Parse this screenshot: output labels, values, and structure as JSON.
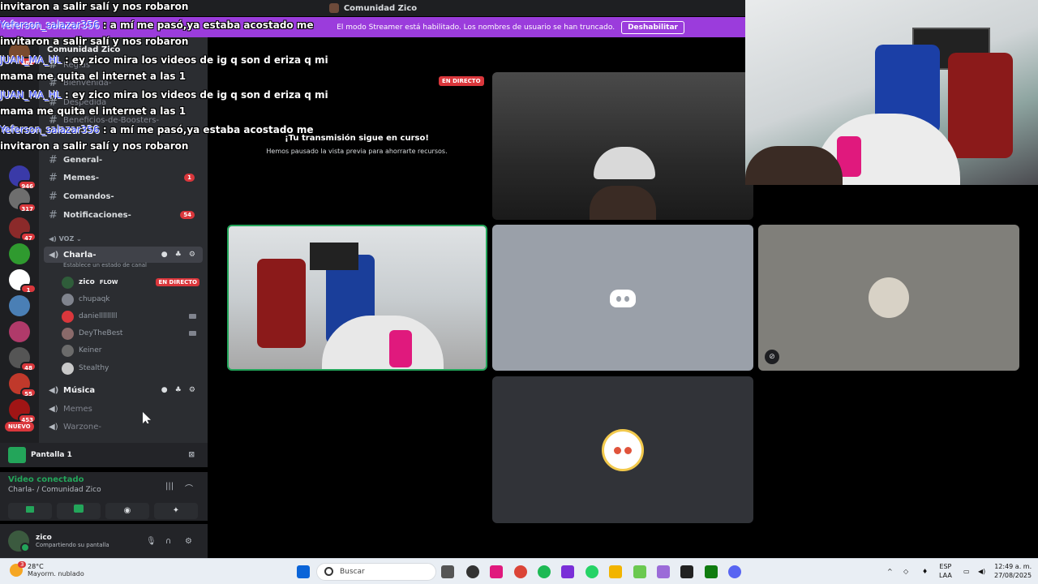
{
  "window": {
    "title": "Comunidad Zico"
  },
  "banner": {
    "text": "El modo Streamer está habilitado. Los nombres de usuario se han truncado.",
    "button": "Deshabilitar"
  },
  "servers": {
    "badges": [
      "682",
      "946",
      "317",
      "47",
      "1",
      "48",
      "55",
      "453"
    ],
    "nuevo": "NUEVO"
  },
  "channel_list": {
    "server_name": "Comunidad Zico",
    "faded": [
      "Reglas",
      "Bienvenida-",
      "Despedida",
      "Beneficios-de-Boosters-"
    ],
    "text_channels": [
      {
        "name": "General-",
        "unread": ""
      },
      {
        "name": "Memes-",
        "unread": "1"
      },
      {
        "name": "Comandos-",
        "unread": ""
      },
      {
        "name": "Notificaciones-",
        "unread": "54"
      }
    ],
    "voice_category": "VOZ",
    "voice_channels": [
      {
        "name": "Charla-",
        "status": "Establece un estado de canal"
      },
      {
        "name": "Música"
      },
      {
        "name": "Memes"
      },
      {
        "name": "Warzone-"
      }
    ],
    "members": [
      {
        "name": "zico",
        "tag": "FLOW",
        "live": "EN DIRECTO"
      },
      {
        "name": "chupaqk"
      },
      {
        "name": "danielllllllll"
      },
      {
        "name": "DeyTheBest"
      },
      {
        "name": "Keiner"
      },
      {
        "name": "Stealthy"
      }
    ]
  },
  "screen_panel": {
    "label": "Pantalla 1"
  },
  "voice_panel": {
    "status": "Video conectado",
    "location": "Charla-  / Comunidad Zico"
  },
  "user_panel": {
    "name": "zico",
    "status": "Compartiendo su pantalla"
  },
  "chat": [
    {
      "user": "",
      "text": "invitaron a salir salí y nos robaron"
    },
    {
      "user": "Yeferson_salazar356",
      "text": " : a mí me pasó,ya estaba acostado me"
    },
    {
      "user": "",
      "text": "invitaron a salir salí y nos robaron"
    },
    {
      "user": "JUAN_MA_HL",
      "text": " : ey zico mira los videos de ig q son d eriza q mi"
    },
    {
      "user": "",
      "text": "mama me quita el internet a las 1"
    },
    {
      "user": "JUAN_MA_HL",
      "text": " : ey zico mira los videos de ig q son d eriza q mi"
    },
    {
      "user": "",
      "text": "mama me quita el internet a las 1"
    },
    {
      "user": "Yeferson_salazar356",
      "text": " : a mí me pasó,ya estaba acostado me"
    },
    {
      "user": "",
      "text": "invitaron a salir salí y nos robaron"
    }
  ],
  "stage": {
    "live_badge": "EN DIRECTO",
    "paused_title": "¡Tu transmisión sigue en curso!",
    "paused_sub": "Hemos pausado la vista previa para ahorrarte recursos."
  },
  "taskbar": {
    "weather_temp": "28°C",
    "weather_desc": "Mayorm. nublado",
    "weather_badge": "3",
    "search": "Buscar",
    "lang": "ESP",
    "lang2": "LAA",
    "time": "12:49 a. m.",
    "date": "27/08/2025"
  },
  "colors": {
    "blurple": "#5865f2",
    "live_red": "#da373c",
    "online_green": "#23a55a",
    "streamer_purple": "#9b3cdc"
  }
}
